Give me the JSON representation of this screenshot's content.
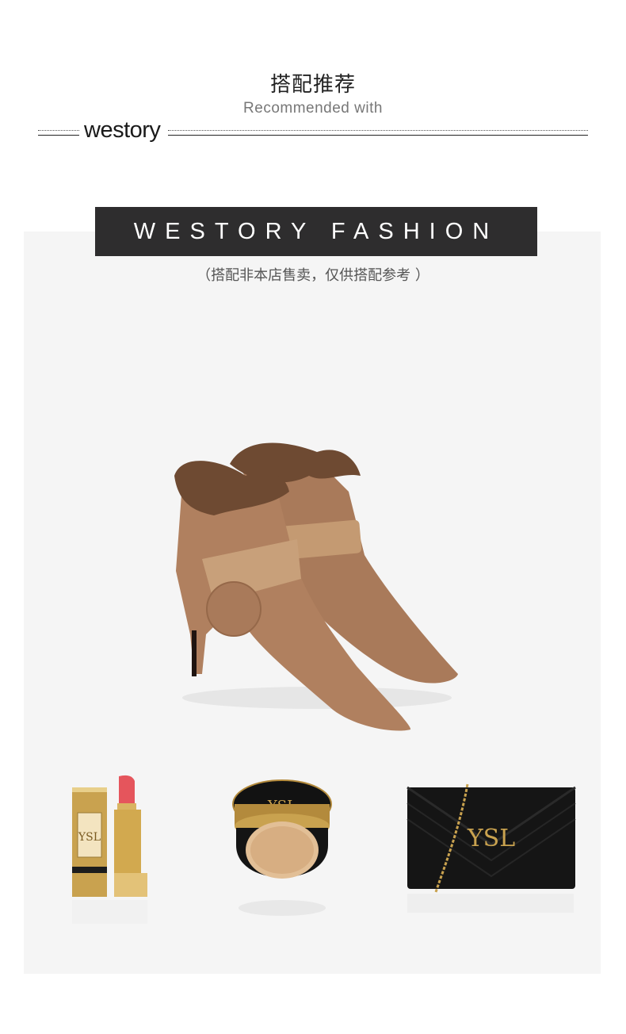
{
  "header": {
    "title_cn": "搭配推荐",
    "title_en": "Recommended with",
    "brand": "westory"
  },
  "banner": {
    "label": "WESTORY FASHION"
  },
  "note": "（搭配非本店售卖，仅供搭配参考 ）",
  "products": [
    {
      "name": "suede-fur-ankle-boots"
    },
    {
      "name": "ysl-lipstick"
    },
    {
      "name": "ysl-cushion-compact"
    },
    {
      "name": "ysl-chain-wallet-bag"
    }
  ],
  "colors": {
    "banner_bg": "#2e2d2e",
    "panel_bg": "#f5f5f5",
    "suede": "#b0805f",
    "gold": "#c9a24f",
    "lipstick": "#e5555c"
  }
}
